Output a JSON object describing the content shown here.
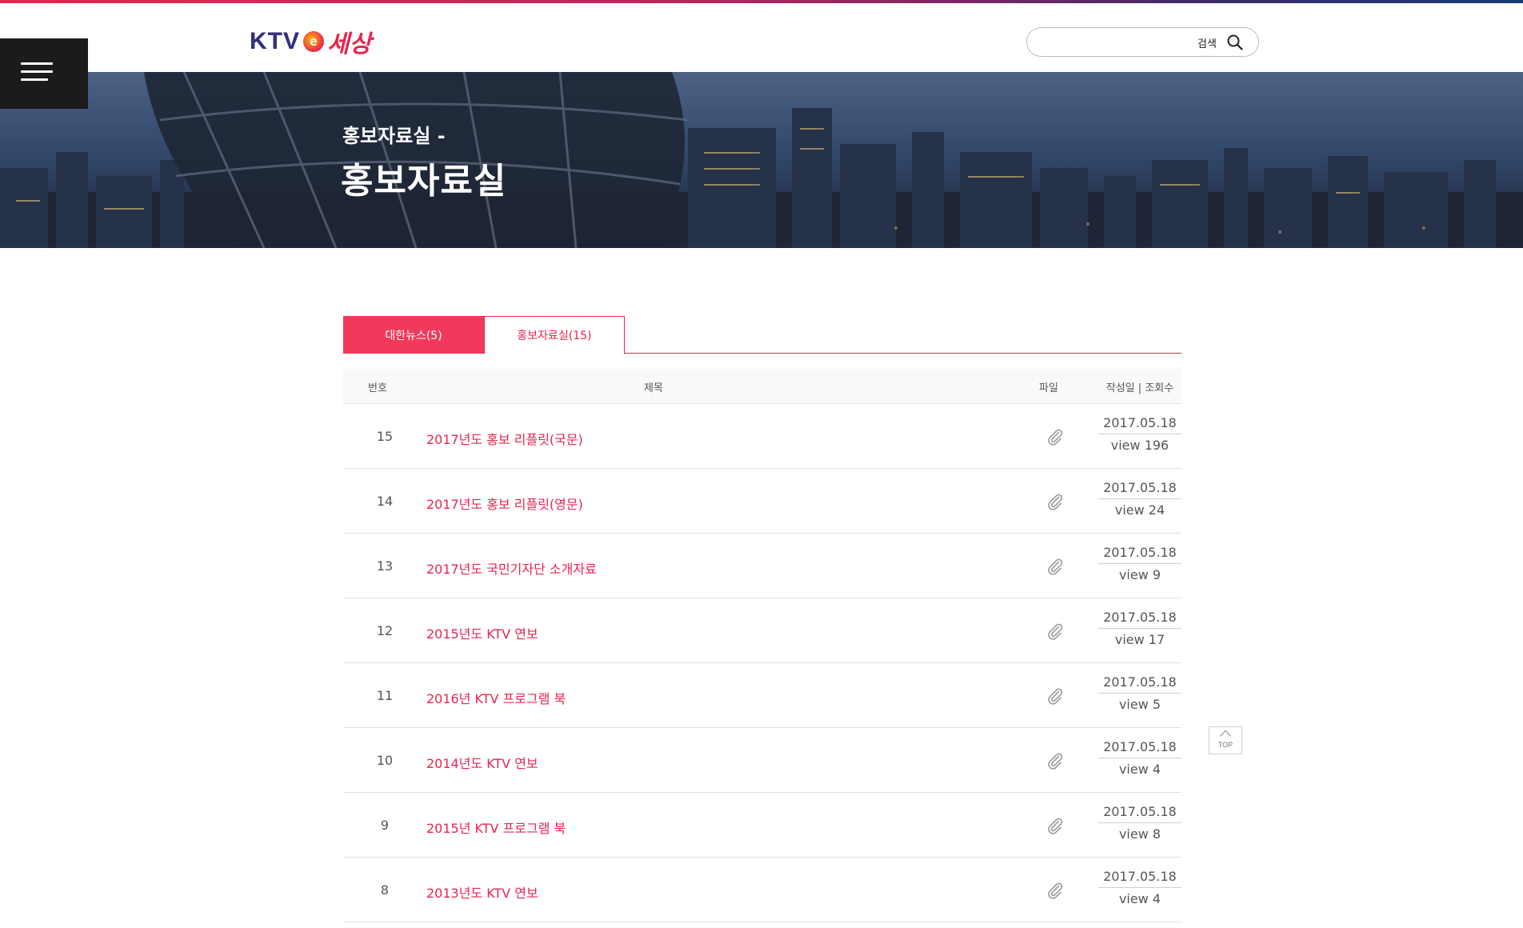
{
  "header": {
    "logo_ktv": "KTV",
    "logo_e": "e",
    "logo_world": "세상",
    "search": {
      "placeholder": "",
      "button_label": "검색"
    },
    "icons": {
      "menu": "hamburger-menu-icon",
      "search": "search-icon"
    }
  },
  "banner": {
    "subtitle": "홍보자료실 -",
    "title": "홍보자료실"
  },
  "tabs": [
    {
      "label": "대한뉴스(5)",
      "active": true
    },
    {
      "label": "홍보자료실(15)",
      "active": false
    }
  ],
  "table": {
    "columns": {
      "num": "번호",
      "title": "제목",
      "file": "파일",
      "date_views": "작성일 | 조회수"
    },
    "rows": [
      {
        "num": "15",
        "title": "2017년도 홍보 리플릿(국문)",
        "date": "2017.05.18",
        "views": "view 196"
      },
      {
        "num": "14",
        "title": "2017년도 홍보 리플릿(영문)",
        "date": "2017.05.18",
        "views": "view 24"
      },
      {
        "num": "13",
        "title": "2017년도 국민기자단 소개자료",
        "date": "2017.05.18",
        "views": "view 9"
      },
      {
        "num": "12",
        "title": "2015년도 KTV 연보",
        "date": "2017.05.18",
        "views": "view 17"
      },
      {
        "num": "11",
        "title": "2016년 KTV 프로그램 북",
        "date": "2017.05.18",
        "views": "view 5"
      },
      {
        "num": "10",
        "title": "2014년도 KTV 연보",
        "date": "2017.05.18",
        "views": "view 4"
      },
      {
        "num": "9",
        "title": "2015년 KTV 프로그램 북",
        "date": "2017.05.18",
        "views": "view 8"
      },
      {
        "num": "8",
        "title": "2013년도 KTV 연보",
        "date": "2017.05.18",
        "views": "view 4"
      }
    ]
  },
  "top_button": {
    "label": "TOP"
  },
  "colors": {
    "accent": "#e8254f",
    "tab_active": "#f13a5b",
    "menu_bg": "#1b1b1b"
  }
}
